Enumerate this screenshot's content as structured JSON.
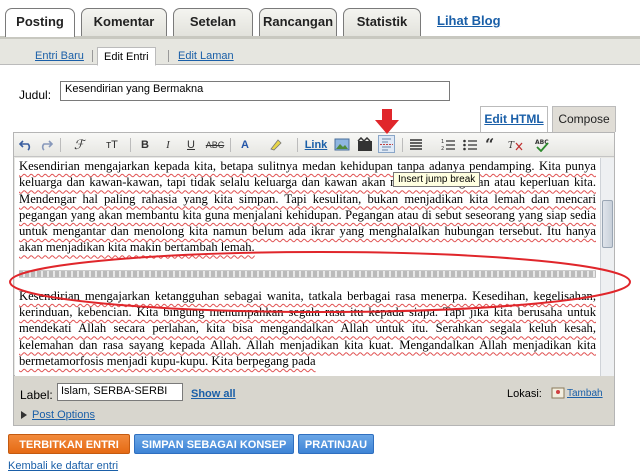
{
  "top_tabs": [
    "Posting",
    "Komentar",
    "Setelan",
    "Rancangan",
    "Statistik"
  ],
  "top_link": "Lihat Blog",
  "sub_tabs": [
    "Entri Baru",
    "Edit Entri",
    "Edit Laman"
  ],
  "title": {
    "label": "Judul:",
    "value": "Kesendirian yang Bermakna"
  },
  "mode_tabs": {
    "html": "Edit HTML",
    "compose": "Compose"
  },
  "toolbar": {
    "bold": "B",
    "italic": "I",
    "underline": "U",
    "strike": "ABC",
    "link": "Link",
    "font": "ℱ",
    "size": "тT",
    "color": "A"
  },
  "tooltip": "Insert jump break",
  "paragraphs": [
    "Kesendirian mengajarkan kepada kita, betapa sulitnya medan kehidupan tanpa adanya pendamping. Kita punya keluarga dan kawan-kawan, tapi tidak selalu keluarga dan kawan akan menemani kegiatan atau keperluan kita. Mendengar hal paling rahasia yang kita simpan. Tapi kesulitan, bukan menjadikan kita lemah dan mencari pegangan yang akan membantu kita guna menjalani kehidupan. Pegangan atau di sebut seseorang yang siap sedia untuk mengantar dan menolong kita namun belum ada ikrar yang menghalalkan hubungan tersebut. Itu hanya akan menjadikan kita makin bertambah lemah.",
    "Kesendirian mengajarkan ketangguhan sebagai wanita, tatkala berbagai rasa menerpa. Kesedihan, kegelisahan, kerinduan, kebencian. Kita bingung menumpahkan segala rasa itu kepada siapa. Tapi jika kita berusaha untuk mendekati Allah secara perlahan, kita bisa mengandalkan Allah untuk itu. Serahkan segala keluh kesah, kelemahan dan rasa sayang kepada Allah. Allah menjadikan kita kuat. Mengandalkan Allah menjadikan kita bermetamorfosis menjadi kupu-kupu. Kita berpegang pada"
  ],
  "labels": {
    "label": "Label:",
    "value": "Islam, SERBA-SERBI",
    "show_all": "Show all",
    "lokasi": "Lokasi:",
    "tambah": "Tambah"
  },
  "post_options": "Post Options",
  "buttons": {
    "publish": "TERBITKAN ENTRI",
    "draft": "SIMPAN SEBAGAI KONSEP",
    "preview": "PRATINJAU"
  },
  "footer_link": "Kembali ke daftar entri",
  "colors": {
    "accent_red": "#e0262b",
    "link_blue": "#1a5fa8",
    "publish_orange": "#e56a14",
    "button_blue": "#3e84d6"
  }
}
